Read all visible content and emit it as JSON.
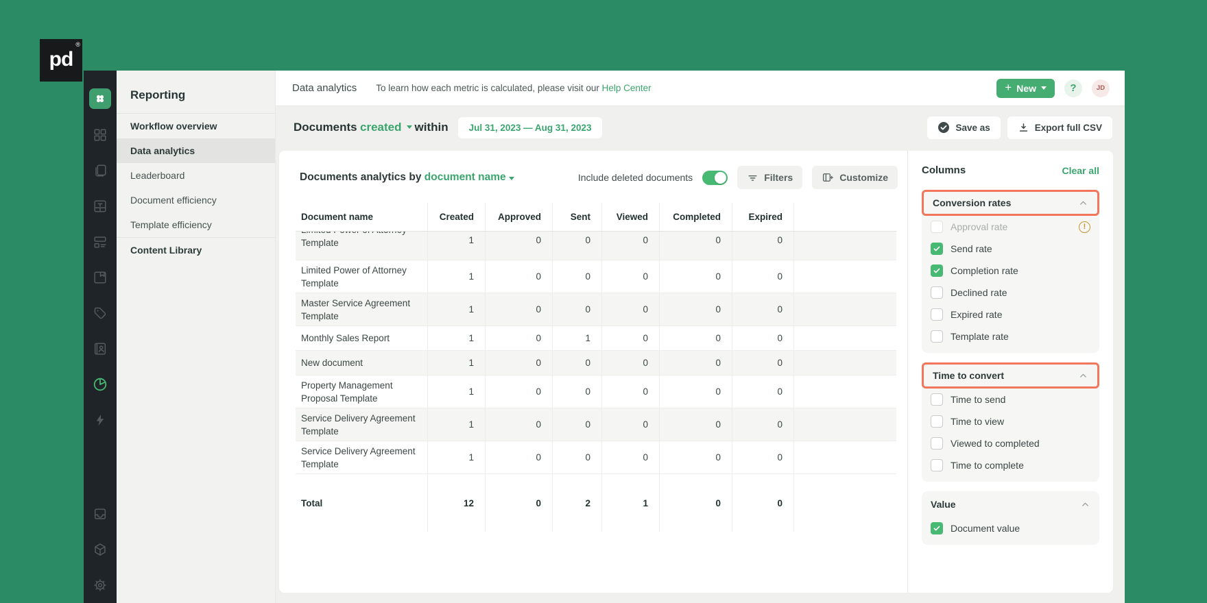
{
  "brand": {
    "logo_text": "pd",
    "registered_mark": "®"
  },
  "nav_rail": {
    "top_icons": [
      {
        "icon": "apps-icon",
        "style": "tile"
      },
      {
        "icon": "dashboard-icon"
      },
      {
        "icon": "documents-icon"
      },
      {
        "icon": "templates-icon"
      },
      {
        "icon": "forms-icon"
      },
      {
        "icon": "content-library-icon"
      },
      {
        "icon": "catalog-icon"
      },
      {
        "icon": "contacts-icon"
      },
      {
        "icon": "reports-icon",
        "active": true
      },
      {
        "icon": "automations-icon"
      }
    ],
    "bottom_icons": [
      {
        "icon": "inbox-icon"
      },
      {
        "icon": "addons-icon"
      },
      {
        "icon": "settings-icon"
      }
    ]
  },
  "sidebar": {
    "title": "Reporting",
    "items": [
      {
        "label": "Workflow overview",
        "bold": true
      },
      {
        "label": "Data analytics",
        "bold": true,
        "selected": true
      },
      {
        "label": "Leaderboard"
      },
      {
        "label": "Document efficiency"
      },
      {
        "label": "Template efficiency"
      },
      {
        "label": "Content Library",
        "bold": true,
        "divider_above": true
      }
    ]
  },
  "header": {
    "page_title": "Data analytics",
    "helper_text": "To learn how each metric is calculated, please visit our",
    "helper_link": "Help Center",
    "new_button_label": "New",
    "help_label": "?",
    "avatar_initials": "JD"
  },
  "filter_bar": {
    "prefix": "Documents",
    "mode_dropdown": "created",
    "connector": "within",
    "date_range": "Jul 31, 2023 — Aug 31, 2023",
    "save_as_label": "Save as",
    "export_label": "Export full CSV"
  },
  "analytics_card": {
    "title_prefix": "Documents analytics by",
    "group_dropdown": "document name",
    "toggle_label": "Include deleted documents",
    "toggle_on": true,
    "filters_label": "Filters",
    "customize_label": "Customize",
    "table": {
      "columns": [
        "Document name",
        "Created",
        "Approved",
        "Sent",
        "Viewed",
        "Completed",
        "Expired"
      ],
      "rows": [
        {
          "name": "Limited Power of Attorney Template",
          "values": [
            1,
            0,
            0,
            0,
            0,
            0
          ],
          "clipped": true
        },
        {
          "name": "Limited Power of Attorney Template",
          "values": [
            1,
            0,
            0,
            0,
            0,
            0
          ]
        },
        {
          "name": "Master Service Agreement Template",
          "values": [
            1,
            0,
            0,
            0,
            0,
            0
          ]
        },
        {
          "name": "Monthly Sales Report",
          "values": [
            1,
            0,
            1,
            0,
            0,
            0
          ]
        },
        {
          "name": "New document",
          "values": [
            1,
            0,
            0,
            0,
            0,
            0
          ]
        },
        {
          "name": "Property Management Proposal Template",
          "values": [
            1,
            0,
            0,
            0,
            0,
            0
          ]
        },
        {
          "name": "Service Delivery Agreement Template",
          "values": [
            1,
            0,
            0,
            0,
            0,
            0
          ]
        },
        {
          "name": "Service Delivery Agreement Template",
          "values": [
            1,
            0,
            0,
            0,
            0,
            0
          ]
        }
      ],
      "total": {
        "label": "Total",
        "values": [
          12,
          0,
          2,
          1,
          0,
          0
        ]
      }
    }
  },
  "columns_panel": {
    "title": "Columns",
    "clear_all_label": "Clear all",
    "sections": [
      {
        "title": "Conversion rates",
        "highlighted": true,
        "items": [
          {
            "label": "Approval rate",
            "state": "disabled",
            "warning": true
          },
          {
            "label": "Send rate",
            "state": "checked"
          },
          {
            "label": "Completion rate",
            "state": "checked"
          },
          {
            "label": "Declined rate",
            "state": "unchecked"
          },
          {
            "label": "Expired rate",
            "state": "unchecked"
          },
          {
            "label": "Template rate",
            "state": "unchecked"
          }
        ]
      },
      {
        "title": "Time to convert",
        "highlighted": true,
        "items": [
          {
            "label": "Time to send",
            "state": "unchecked"
          },
          {
            "label": "Time to view",
            "state": "unchecked"
          },
          {
            "label": "Viewed to completed",
            "state": "unchecked"
          },
          {
            "label": "Time to complete",
            "state": "unchecked"
          }
        ]
      },
      {
        "title": "Value",
        "highlighted": false,
        "items": [
          {
            "label": "Document value",
            "state": "checked"
          }
        ]
      }
    ]
  },
  "colors": {
    "background_green": "#2b8b64",
    "brand_green": "#47b972",
    "link_green": "#3ba56e",
    "accent_orange": "#f2765c",
    "warning_amber": "#c8932e"
  }
}
